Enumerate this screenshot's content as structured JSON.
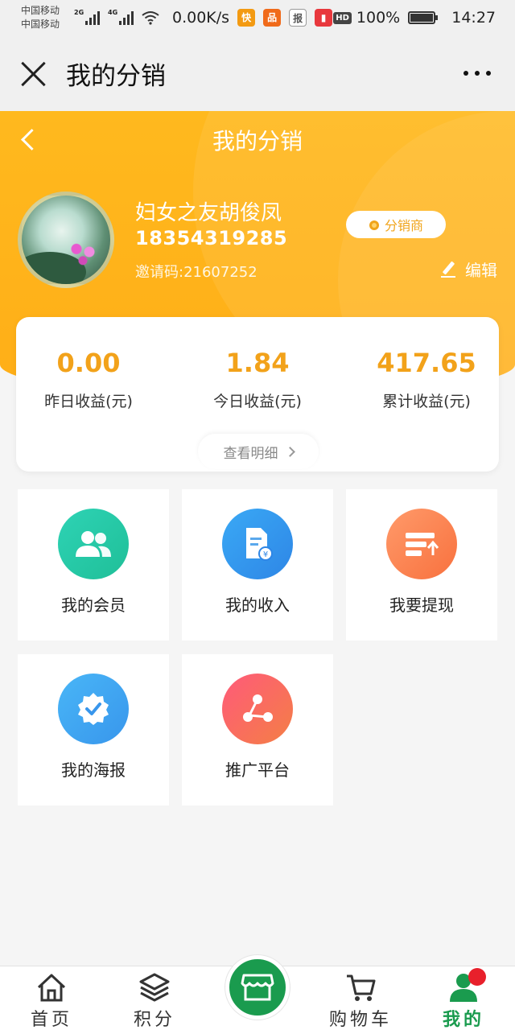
{
  "status_bar": {
    "carrier1": "中国移动",
    "carrier2": "中国移动",
    "net1": "2G",
    "net2": "4G",
    "speed": "0.00K/s",
    "hd": "HD",
    "battery": "100%",
    "time": "14:27"
  },
  "title_bar": {
    "title": "我的分销"
  },
  "hero": {
    "title": "我的分销",
    "user_name": "妇女之友胡俊凤",
    "phone": "18354319285",
    "invite_code": "邀请码:21607252",
    "badge": "分销商",
    "edit": "编辑"
  },
  "earnings": {
    "yesterday_value": "0.00",
    "yesterday_label": "昨日收益(元)",
    "today_value": "1.84",
    "today_label": "今日收益(元)",
    "total_value": "417.65",
    "total_label": "累计收益(元)",
    "detail": "查看明细"
  },
  "grid": {
    "members": "我的会员",
    "income": "我的收入",
    "withdraw": "我要提现",
    "poster": "我的海报",
    "promote": "推广平台"
  },
  "nav": {
    "home": "首页",
    "points": "积分",
    "cart": "购物车",
    "mine": "我的"
  },
  "colors": {
    "accent_orange": "#ffb91e",
    "value_orange": "#f2a21a",
    "nav_green": "#1a9b4e"
  }
}
